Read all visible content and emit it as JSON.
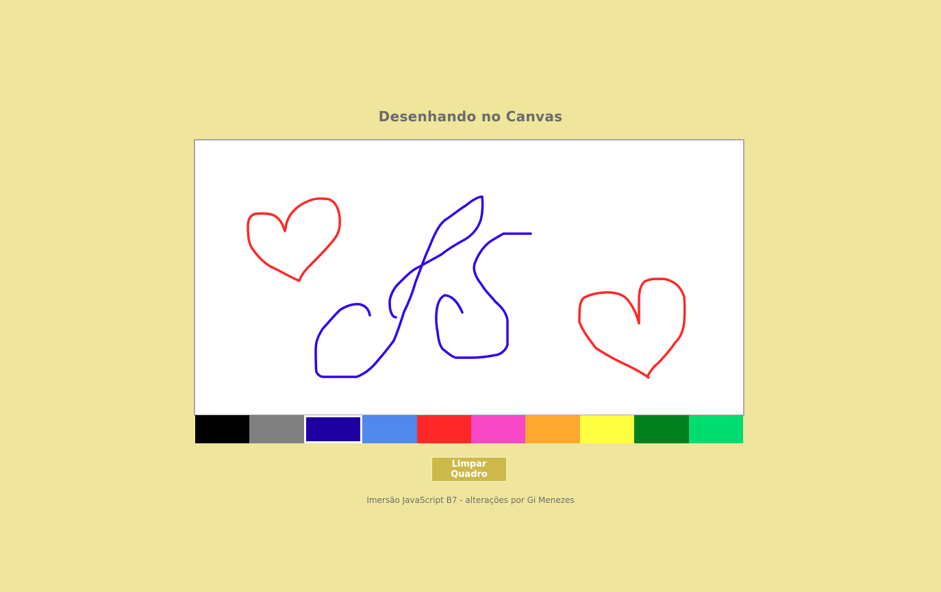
{
  "page": {
    "title": "Desenhando no Canvas",
    "background_color": "#efe59c"
  },
  "canvas": {
    "background_color": "#ffffff",
    "strokes": [
      {
        "color": "#ff2828",
        "label": "heart-left"
      },
      {
        "color": "#3300ee",
        "label": "letter-a"
      },
      {
        "color": "#3300ee",
        "label": "letter-b"
      },
      {
        "color": "#ff2828",
        "label": "heart-right"
      }
    ]
  },
  "palette": {
    "colors": [
      {
        "color": "#000000",
        "selected": false
      },
      {
        "color": "#808080",
        "selected": false
      },
      {
        "color": "#1e00a0",
        "selected": true
      },
      {
        "color": "#5088ec",
        "selected": false
      },
      {
        "color": "#ff2828",
        "selected": false
      },
      {
        "color": "#f848c8",
        "selected": false
      },
      {
        "color": "#ffa830",
        "selected": false
      },
      {
        "color": "#ffff40",
        "selected": false
      },
      {
        "color": "#00801e",
        "selected": false
      },
      {
        "color": "#00dc70",
        "selected": false
      }
    ]
  },
  "actions": {
    "clear_label": "Limpar Quadro"
  },
  "footer": {
    "text": "Imersão JavaScript B7 - alterações por Gi Menezes"
  }
}
